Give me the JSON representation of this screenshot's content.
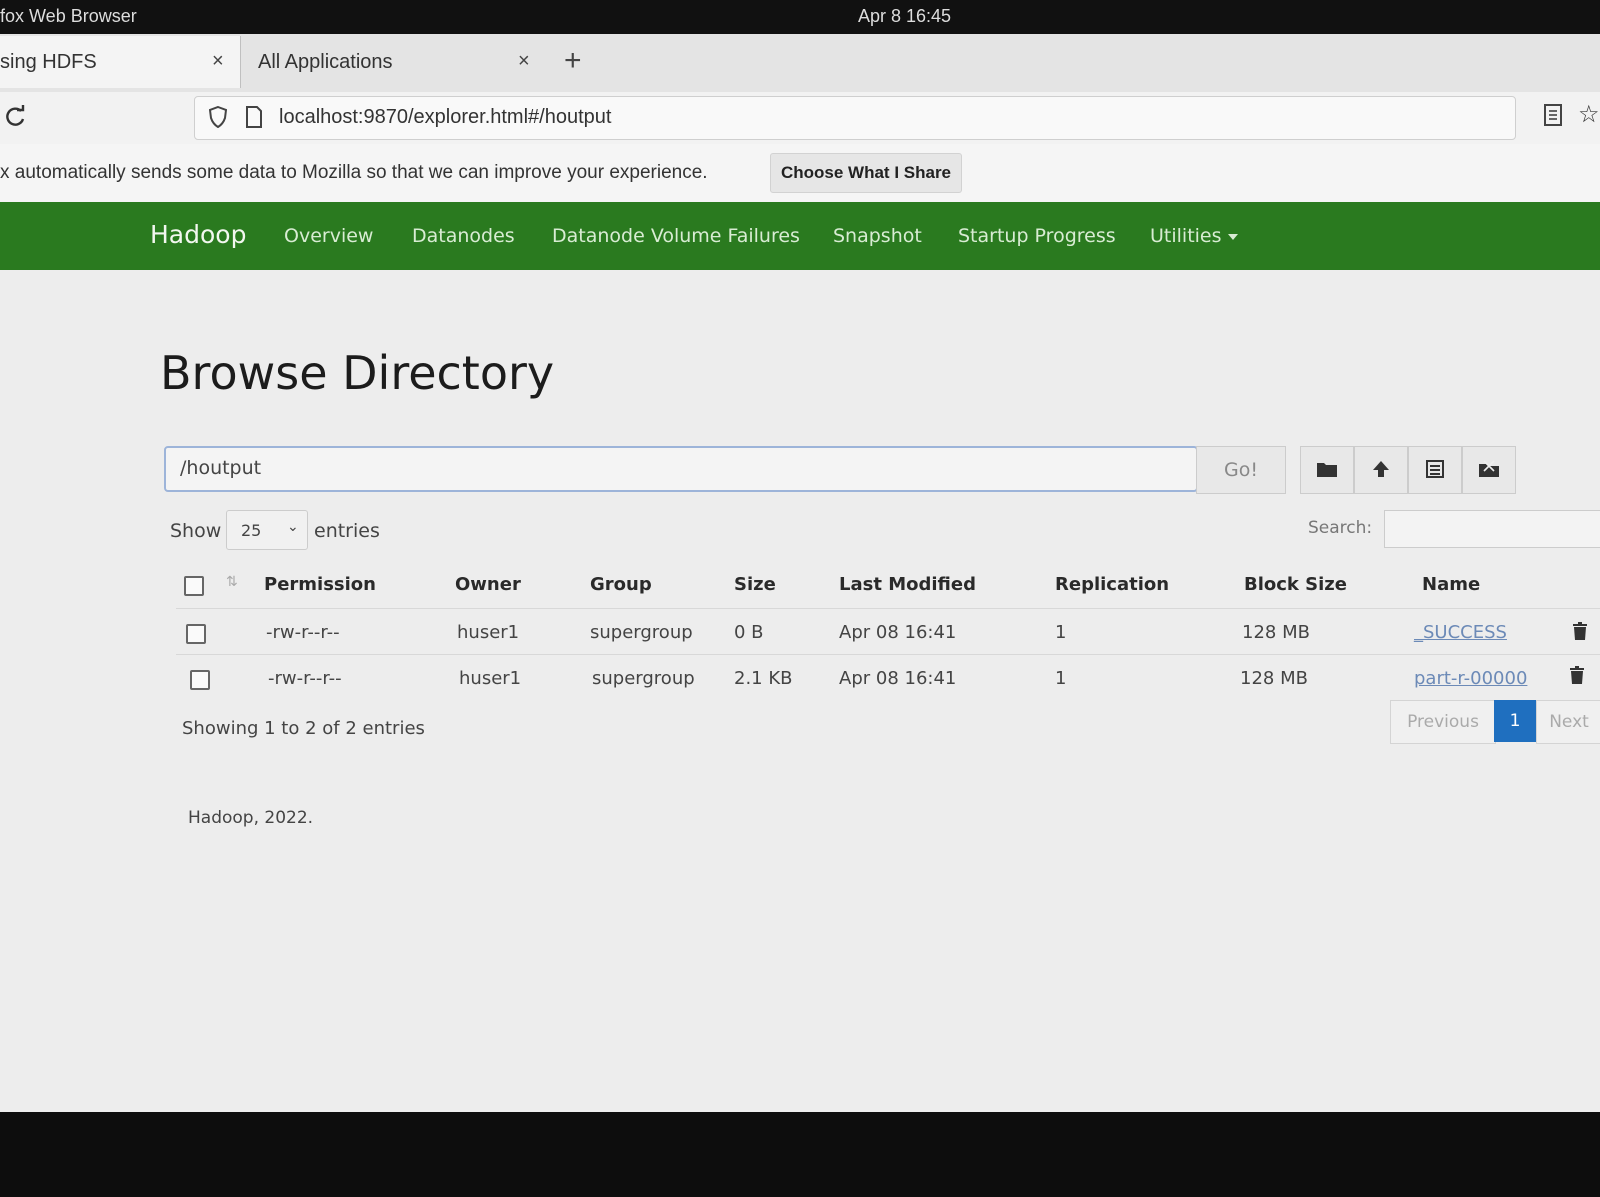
{
  "os_bar": {
    "app": "fox Web Browser",
    "clock": "Apr 8  16:45"
  },
  "tabs": [
    {
      "label": "sing HDFS"
    },
    {
      "label": "All Applications"
    }
  ],
  "tab_close_glyph": "×",
  "new_tab_glyph": "+",
  "url": "localhost:9870/explorer.html#/houtput",
  "notice": {
    "message": "x automatically sends some data to Mozilla so that we can improve your experience.",
    "button": "Choose What I Share"
  },
  "hadoop_nav": {
    "brand": "Hadoop",
    "items": [
      "Overview",
      "Datanodes",
      "Datanode Volume Failures",
      "Snapshot",
      "Startup Progress",
      "Utilities"
    ]
  },
  "page": {
    "title": "Browse Directory",
    "path_value": "/houtput",
    "go_label": "Go!",
    "show_label": "Show",
    "entries_value": "25",
    "entries_label": "entries",
    "search_label": "Search:",
    "showing_text": "Showing 1 to 2 of 2 entries",
    "pagination": {
      "previous": "Previous",
      "current": "1",
      "next": "Next"
    },
    "footer": "Hadoop, 2022."
  },
  "table": {
    "headers": [
      "Permission",
      "Owner",
      "Group",
      "Size",
      "Last Modified",
      "Replication",
      "Block Size",
      "Name"
    ],
    "rows": [
      {
        "permission": "-rw-r--r--",
        "owner": "huser1",
        "group": "supergroup",
        "size": "0 B",
        "modified": "Apr 08 16:41",
        "replication": "1",
        "block_size": "128 MB",
        "name": "_SUCCESS"
      },
      {
        "permission": "-rw-r--r--",
        "owner": "huser1",
        "group": "supergroup",
        "size": "2.1 KB",
        "modified": "Apr 08 16:41",
        "replication": "1",
        "block_size": "128 MB",
        "name": "part-r-00000"
      }
    ]
  },
  "colors": {
    "navbar_green": "#2a7a1f",
    "active_page_blue": "#1f6fbf",
    "link_blue": "#6c8ab7"
  },
  "icons": [
    "reload-icon",
    "shield-icon",
    "page-icon",
    "reader-view-icon",
    "bookmark-star-icon",
    "create-folder-icon",
    "upload-icon",
    "cut-paste-icon",
    "delete-folder-icon",
    "sort-icon",
    "trash-icon"
  ]
}
